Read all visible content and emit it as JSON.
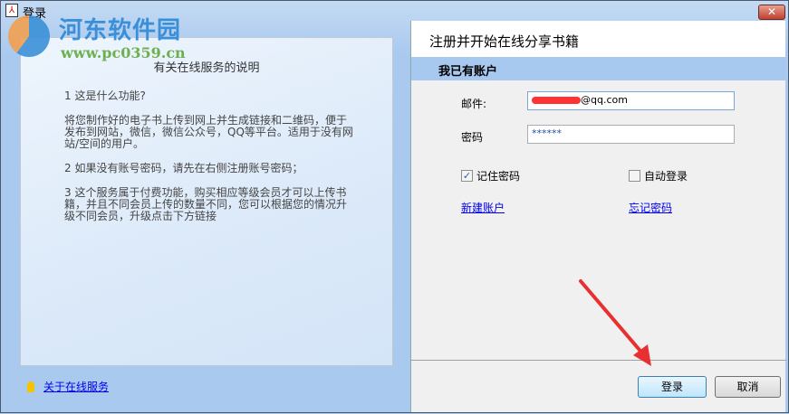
{
  "window": {
    "title": "登录",
    "close_symbol": "✕"
  },
  "watermark": {
    "name": "河东软件园",
    "url": "www.pc0359.cn"
  },
  "left": {
    "title": "有关在线服务的说明",
    "paragraphs": [
      "1 这是什么功能?",
      "将您制作好的电子书上传到网上并生成链接和二维码，便于发布到网站，微信，微信公众号，QQ等平台。适用于没有网站/空间的用户。",
      "2 如果没有账号密码，请先在右侧注册账号密码；",
      "3 这个服务属于付费功能，购买相应等级会员才可以上传书籍，并且不同会员上传的数量不同，您可以根据您的情况升级不同会员，升级点击下方链接"
    ],
    "about_link": "关于在线服务"
  },
  "right": {
    "header": "注册并开始在线分享书籍",
    "section": "我已有账户",
    "email_label": "邮件:",
    "email_value_suffix": "@qq.com",
    "password_label": "密码",
    "password_value": "******",
    "remember_label": "记住密码",
    "remember_checked": true,
    "autologin_label": "自动登录",
    "autologin_checked": false,
    "new_account": "新建账户",
    "forgot_password": "忘记密码",
    "login_button": "登录",
    "cancel_button": "取消"
  },
  "colors": {
    "accent": "#a8c9ef",
    "annotation_arrow": "#e83030"
  }
}
